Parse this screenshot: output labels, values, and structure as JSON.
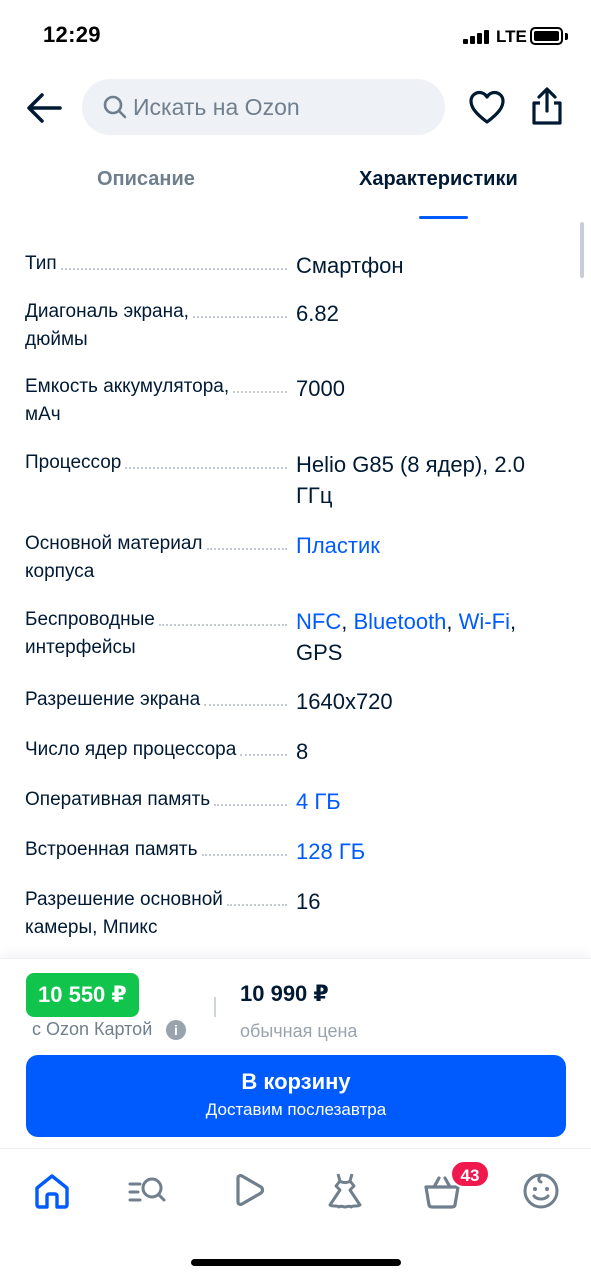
{
  "status_bar": {
    "time": "12:29",
    "network": "LTE"
  },
  "header": {
    "search_placeholder": "Искать на Ozon",
    "icons": [
      "back-arrow-icon",
      "search-icon",
      "heart-icon",
      "share-icon"
    ]
  },
  "tabs": [
    {
      "label": "Описание",
      "active": false
    },
    {
      "label": "Характеристики",
      "active": true
    }
  ],
  "specs": [
    {
      "label": "Тип",
      "value": "Смартфон"
    },
    {
      "label": "Диагональ экрана,\nдюймы",
      "value": "6.82"
    },
    {
      "label": "Емкость аккумулятора,\nмАч",
      "value": "7000"
    },
    {
      "label": "Процессор",
      "value": "Helio G85 (8 ядер), 2.0 ГГц"
    },
    {
      "label": "Основной материал\nкорпуса",
      "value": "Пластик"
    },
    {
      "label": "Беспроводные\nинтерфейсы",
      "links": [
        "NFC",
        "Bluetooth",
        "Wi-Fi"
      ],
      "tail": "GPS"
    },
    {
      "label": "Разрешение экрана",
      "value": "1640x720"
    },
    {
      "label": "Число ядер процессора",
      "value": "8"
    },
    {
      "label": "Оперативная память",
      "value": "4 ГБ"
    },
    {
      "label": "Встроенная память",
      "value": "128 ГБ"
    },
    {
      "label": "Разрешение основной\nкамеры, Мпикс",
      "value": "16"
    }
  ],
  "purchase": {
    "card_price": "10 550 ₽",
    "card_caption": "с Ozon Картой",
    "regular_price": "10 990 ₽",
    "regular_caption": "обычная цена",
    "cart_button": "В корзину",
    "cart_button_sub": "Доставим послезавтра"
  },
  "bottom_nav": {
    "items": [
      "home-icon",
      "catalog-icon",
      "video-icon",
      "fresh-icon",
      "cart-icon",
      "profile-icon"
    ],
    "cart_count": "43"
  },
  "colors": {
    "accent": "#005bff",
    "green": "#10c44c",
    "badge": "#f1184d",
    "text": "#001a34",
    "muted": "#707f8d"
  }
}
